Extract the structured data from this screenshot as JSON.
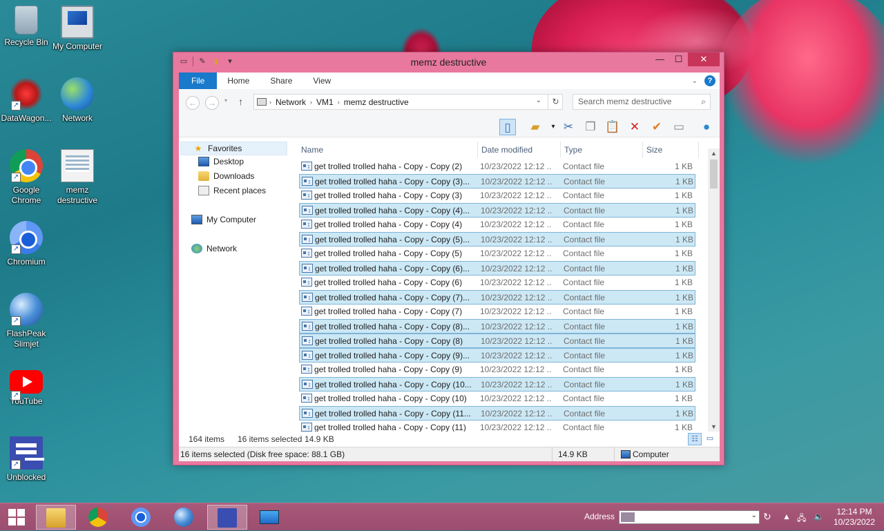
{
  "desktop": {
    "icons": [
      {
        "label": "Recycle Bin",
        "icon": "recycle-bin-icon"
      },
      {
        "label": "My Computer",
        "icon": "computer-icon"
      },
      {
        "label": "DataWagon...",
        "icon": "datawagon-icon"
      },
      {
        "label": "Network",
        "icon": "network-icon"
      },
      {
        "label": "Google Chrome",
        "icon": "chrome-icon"
      },
      {
        "label": "memz destructive",
        "icon": "folder-document-icon"
      },
      {
        "label": "Chromium",
        "icon": "chromium-icon"
      },
      {
        "label": "FlashPeak Slimjet",
        "icon": "slimjet-icon"
      },
      {
        "label": "YouTube",
        "icon": "youtube-icon"
      },
      {
        "label": "Unblocked",
        "icon": "unblocked-icon"
      }
    ]
  },
  "window": {
    "title": "memz destructive",
    "ribbon_tabs": [
      "File",
      "Home",
      "Share",
      "View"
    ],
    "help_label": "?",
    "address": {
      "crumbs": [
        "Network",
        "VM1",
        "memz destructive"
      ]
    },
    "search": {
      "placeholder": "Search memz destructive"
    },
    "nav": {
      "favorites": "Favorites",
      "desktop": "Desktop",
      "downloads": "Downloads",
      "recent": "Recent places",
      "my_computer": "My Computer",
      "network": "Network"
    },
    "columns": {
      "name": "Name",
      "date": "Date modified",
      "type": "Type",
      "size": "Size"
    },
    "files": [
      {
        "name": "get trolled trolled haha - Copy - Copy (2)",
        "date": "10/23/2022 12:12 ...",
        "type": "Contact file",
        "size": "1 KB",
        "selected": false
      },
      {
        "name": "get trolled trolled haha - Copy - Copy (3)...",
        "date": "10/23/2022 12:12 ...",
        "type": "Contact file",
        "size": "1 KB",
        "selected": true
      },
      {
        "name": "get trolled trolled haha - Copy - Copy (3)",
        "date": "10/23/2022 12:12 ...",
        "type": "Contact file",
        "size": "1 KB",
        "selected": false
      },
      {
        "name": "get trolled trolled haha - Copy - Copy (4)...",
        "date": "10/23/2022 12:12 ...",
        "type": "Contact file",
        "size": "1 KB",
        "selected": true
      },
      {
        "name": "get trolled trolled haha - Copy - Copy (4)",
        "date": "10/23/2022 12:12 ...",
        "type": "Contact file",
        "size": "1 KB",
        "selected": false
      },
      {
        "name": "get trolled trolled haha - Copy - Copy (5)...",
        "date": "10/23/2022 12:12 ...",
        "type": "Contact file",
        "size": "1 KB",
        "selected": true
      },
      {
        "name": "get trolled trolled haha - Copy - Copy (5)",
        "date": "10/23/2022 12:12 ...",
        "type": "Contact file",
        "size": "1 KB",
        "selected": false
      },
      {
        "name": "get trolled trolled haha - Copy - Copy (6)...",
        "date": "10/23/2022 12:12 ...",
        "type": "Contact file",
        "size": "1 KB",
        "selected": true
      },
      {
        "name": "get trolled trolled haha - Copy - Copy (6)",
        "date": "10/23/2022 12:12 ...",
        "type": "Contact file",
        "size": "1 KB",
        "selected": false
      },
      {
        "name": "get trolled trolled haha - Copy - Copy (7)...",
        "date": "10/23/2022 12:12 ...",
        "type": "Contact file",
        "size": "1 KB",
        "selected": true
      },
      {
        "name": "get trolled trolled haha - Copy - Copy (7)",
        "date": "10/23/2022 12:12 ...",
        "type": "Contact file",
        "size": "1 KB",
        "selected": false
      },
      {
        "name": "get trolled trolled haha - Copy - Copy (8)...",
        "date": "10/23/2022 12:12 ...",
        "type": "Contact file",
        "size": "1 KB",
        "selected": true
      },
      {
        "name": "get trolled trolled haha - Copy - Copy (8)",
        "date": "10/23/2022 12:12 ...",
        "type": "Contact file",
        "size": "1 KB",
        "selected": true
      },
      {
        "name": "get trolled trolled haha - Copy - Copy (9)...",
        "date": "10/23/2022 12:12 ...",
        "type": "Contact file",
        "size": "1 KB",
        "selected": true
      },
      {
        "name": "get trolled trolled haha - Copy - Copy (9)",
        "date": "10/23/2022 12:12 ...",
        "type": "Contact file",
        "size": "1 KB",
        "selected": false
      },
      {
        "name": "get trolled trolled haha - Copy - Copy (10...",
        "date": "10/23/2022 12:12 ...",
        "type": "Contact file",
        "size": "1 KB",
        "selected": true
      },
      {
        "name": "get trolled trolled haha - Copy - Copy (10)",
        "date": "10/23/2022 12:12 ...",
        "type": "Contact file",
        "size": "1 KB",
        "selected": false
      },
      {
        "name": "get trolled trolled haha - Copy - Copy (11...",
        "date": "10/23/2022 12:12 ...",
        "type": "Contact file",
        "size": "1 KB",
        "selected": true
      },
      {
        "name": "get trolled trolled haha - Copy - Copy (11)",
        "date": "10/23/2022 12:12 ...",
        "type": "Contact file",
        "size": "1 KB",
        "selected": false
      }
    ],
    "info": {
      "count": "164 items",
      "selected": "16 items selected",
      "size": "14.9 KB"
    },
    "status": {
      "left": "16 items selected (Disk free space: 88.1 GB)",
      "size": "14.9 KB",
      "location": "Computer"
    }
  },
  "taskbar": {
    "address_label": "Address",
    "time": "12:14 PM",
    "date": "10/23/2022"
  },
  "colors": {
    "window_frame": "#e8789e",
    "selection": "#cce8f5",
    "file_tab": "#1979ca",
    "close": "#c7355a"
  }
}
